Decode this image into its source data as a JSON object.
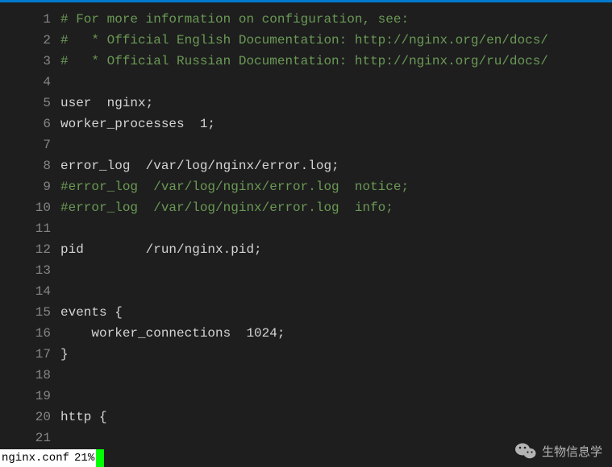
{
  "code_lines": [
    {
      "n": 1,
      "parts": [
        {
          "cls": "tok-comment",
          "t": "# For more information on configuration, see:"
        }
      ]
    },
    {
      "n": 2,
      "parts": [
        {
          "cls": "tok-comment",
          "t": "#   * Official English Documentation: http://nginx.org/en/docs/"
        }
      ]
    },
    {
      "n": 3,
      "parts": [
        {
          "cls": "tok-comment",
          "t": "#   * Official Russian Documentation: http://nginx.org/ru/docs/"
        }
      ]
    },
    {
      "n": 4,
      "parts": []
    },
    {
      "n": 5,
      "parts": [
        {
          "cls": "tok-normal",
          "t": "user  nginx;"
        }
      ]
    },
    {
      "n": 6,
      "parts": [
        {
          "cls": "tok-normal",
          "t": "worker_processes  1;"
        }
      ]
    },
    {
      "n": 7,
      "parts": []
    },
    {
      "n": 8,
      "parts": [
        {
          "cls": "tok-normal",
          "t": "error_log  /var/log/nginx/error.log;"
        }
      ]
    },
    {
      "n": 9,
      "parts": [
        {
          "cls": "tok-comment",
          "t": "#error_log  /var/log/nginx/error.log  notice;"
        }
      ]
    },
    {
      "n": 10,
      "parts": [
        {
          "cls": "tok-comment",
          "t": "#error_log  /var/log/nginx/error.log  info;"
        }
      ]
    },
    {
      "n": 11,
      "parts": []
    },
    {
      "n": 12,
      "parts": [
        {
          "cls": "tok-normal",
          "t": "pid        /run/nginx.pid;"
        }
      ]
    },
    {
      "n": 13,
      "parts": []
    },
    {
      "n": 14,
      "parts": []
    },
    {
      "n": 15,
      "parts": [
        {
          "cls": "tok-normal",
          "t": "events {"
        }
      ]
    },
    {
      "n": 16,
      "parts": [
        {
          "cls": "tok-normal",
          "t": "    worker_connections  1024;"
        }
      ]
    },
    {
      "n": 17,
      "parts": [
        {
          "cls": "tok-normal",
          "t": "}"
        }
      ]
    },
    {
      "n": 18,
      "parts": []
    },
    {
      "n": 19,
      "parts": []
    },
    {
      "n": 20,
      "parts": [
        {
          "cls": "tok-normal",
          "t": "http {"
        }
      ]
    },
    {
      "n": 21,
      "parts": []
    }
  ],
  "status": {
    "filename": "nginx.conf",
    "percent": "21%"
  },
  "watermark": {
    "label": "生物信息学"
  }
}
